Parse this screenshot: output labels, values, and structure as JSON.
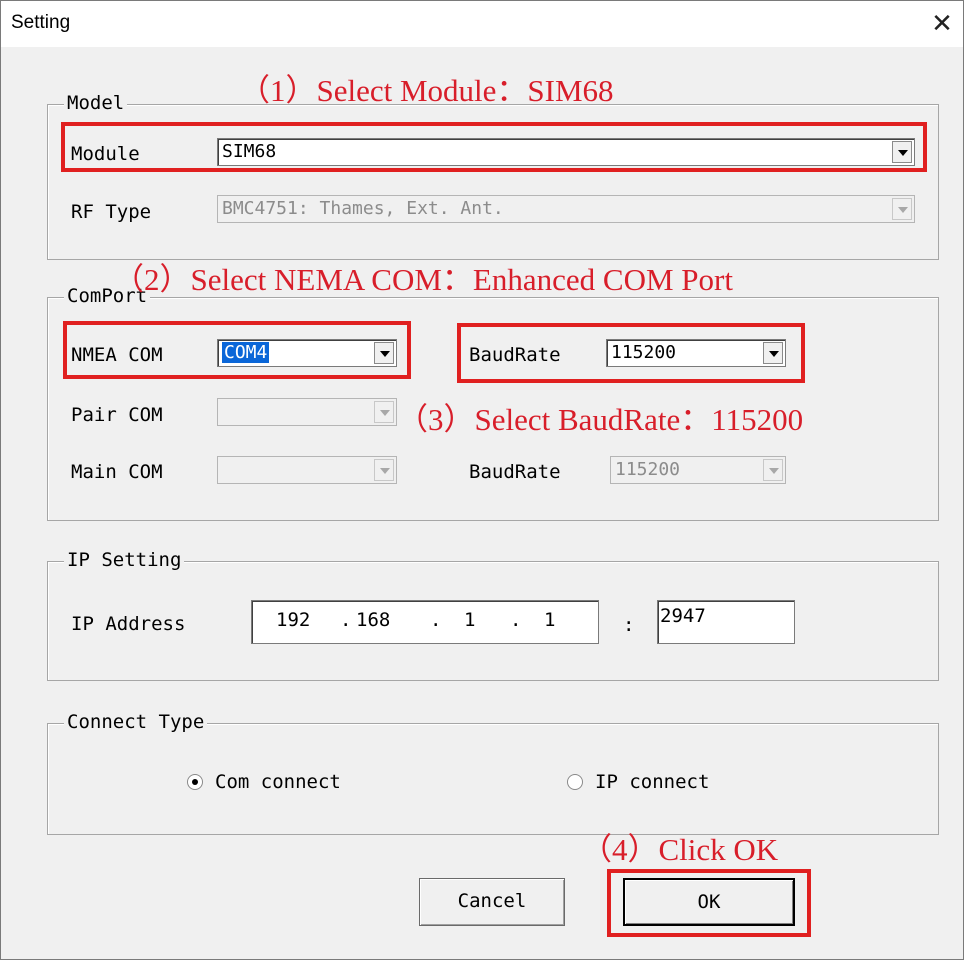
{
  "window": {
    "title": "Setting"
  },
  "annotations": {
    "step1": "（1）Select Module：SIM68",
    "step2": "（2）Select NEMA COM：Enhanced  COM Port",
    "step3": "（3）Select BaudRate：115200",
    "step4": "（4）Click OK",
    "highlight_color": "#e02020"
  },
  "model": {
    "legend": "Model",
    "module_label": "Module",
    "module_value": "SIM68",
    "rf_type_label": "RF Type",
    "rf_type_value": "BMC4751: Thames, Ext. Ant."
  },
  "comport": {
    "legend": "ComPort",
    "nmea_label": "NMEA COM",
    "nmea_value": "COM4",
    "baudrate_label": "BaudRate",
    "baudrate_value": "115200",
    "pair_label": "Pair COM",
    "pair_value": "",
    "main_label": "Main COM",
    "main_value": "",
    "baudrate2_label": "BaudRate",
    "baudrate2_value": "115200"
  },
  "ip": {
    "legend": "IP Setting",
    "address_label": "IP Address",
    "octet1": "192",
    "octet2": "168",
    "octet3": "1",
    "octet4": "1",
    "dot": ".",
    "colon": ":",
    "port": "2947"
  },
  "connect": {
    "legend": "Connect Type",
    "com_label": "Com connect",
    "ip_label": "IP connect",
    "selected": "com"
  },
  "buttons": {
    "cancel": "Cancel",
    "ok": "OK"
  }
}
